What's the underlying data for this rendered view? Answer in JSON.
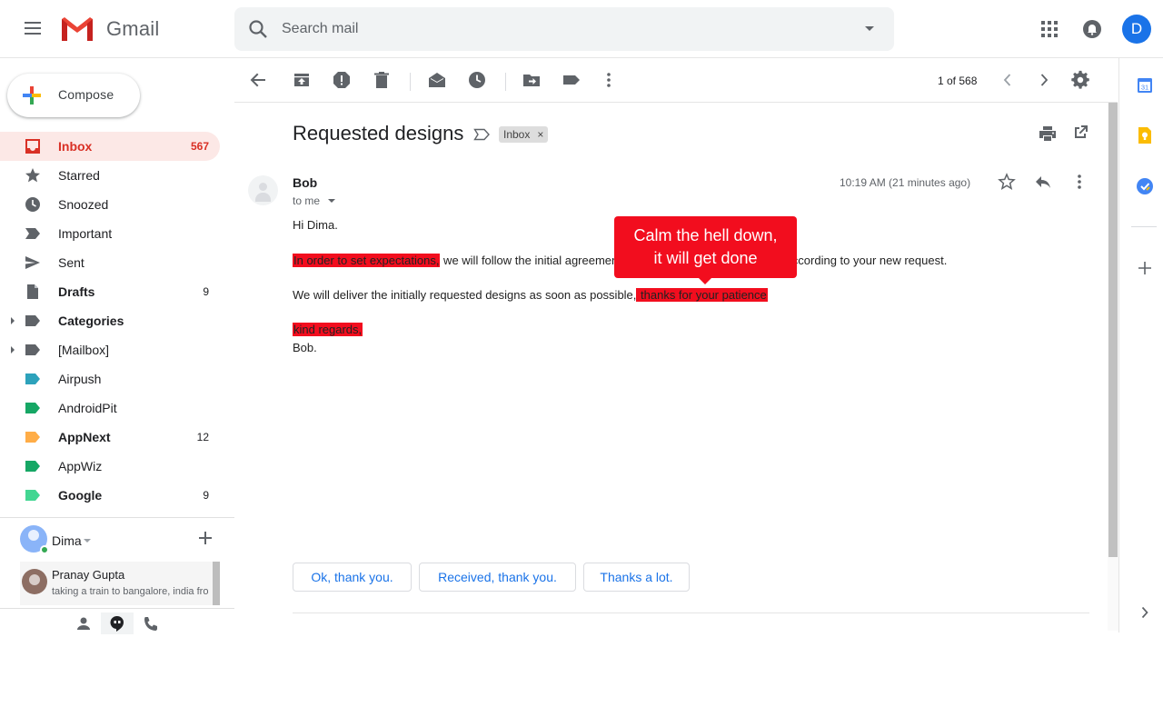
{
  "header": {
    "brand": "Gmail",
    "search_placeholder": "Search mail",
    "avatar_letter": "D"
  },
  "compose": {
    "label": "Compose"
  },
  "sidebar": {
    "items": [
      {
        "label": "Inbox",
        "count": "567",
        "icon": "inbox-icon",
        "active": true,
        "bold": true
      },
      {
        "label": "Starred",
        "count": "",
        "icon": "star-icon"
      },
      {
        "label": "Snoozed",
        "count": "",
        "icon": "clock-icon"
      },
      {
        "label": "Important",
        "count": "",
        "icon": "important-icon"
      },
      {
        "label": "Sent",
        "count": "",
        "icon": "send-icon"
      },
      {
        "label": "Drafts",
        "count": "9",
        "icon": "draft-icon",
        "bold": true
      },
      {
        "label": "Categories",
        "count": "",
        "icon": "label-icon",
        "bold": true,
        "expandable": true,
        "color": "#5f6368"
      },
      {
        "label": "[Mailbox]",
        "count": "",
        "icon": "label-icon",
        "expandable": true,
        "color": "#5f6368"
      },
      {
        "label": "Airpush",
        "count": "",
        "icon": "label-icon",
        "color": "#2da2bb"
      },
      {
        "label": "AndroidPit",
        "count": "",
        "icon": "label-icon",
        "color": "#16a765"
      },
      {
        "label": "AppNext",
        "count": "12",
        "icon": "label-icon",
        "bold": true,
        "color": "#ffad47"
      },
      {
        "label": "AppWiz",
        "count": "",
        "icon": "label-icon",
        "color": "#16a765"
      },
      {
        "label": "Google",
        "count": "9",
        "icon": "label-icon",
        "bold": true,
        "color": "#43d692"
      }
    ]
  },
  "hangouts": {
    "user": "Dima",
    "contact_name": "Pranay Gupta",
    "contact_status": "taking a train to bangalore, india fro"
  },
  "toolbar": {
    "pager": "1 of 568"
  },
  "email": {
    "subject": "Requested designs",
    "label_chip": "Inbox",
    "label_chip_close": "×",
    "sender": "Bob",
    "recipient": "to me",
    "time": "10:19 AM (21 minutes ago)",
    "greeting": "Hi Dima.",
    "line1_highlight": "In order to set expectations,",
    "line1_rest": " we will follow the initial agreement and then evaluate the designs according to your new request.",
    "line2_start": "We will deliver the initially requested designs as soon as possible,",
    "line2_highlight": " thanks for your patience ",
    "closing_highlight": "kind regards,",
    "signature": "Bob."
  },
  "callout": {
    "line1": "Calm the hell down,",
    "line2": "it will get done"
  },
  "smart_replies": [
    "Ok, thank you.",
    "Received, thank you.",
    "Thanks a lot."
  ],
  "right_panel": {
    "calendar_day": "31"
  },
  "colors": {
    "accent_red": "#d93025",
    "highlight_red": "#f20d1e",
    "link_blue": "#1a73e8",
    "active_bg": "#fce8e6"
  }
}
